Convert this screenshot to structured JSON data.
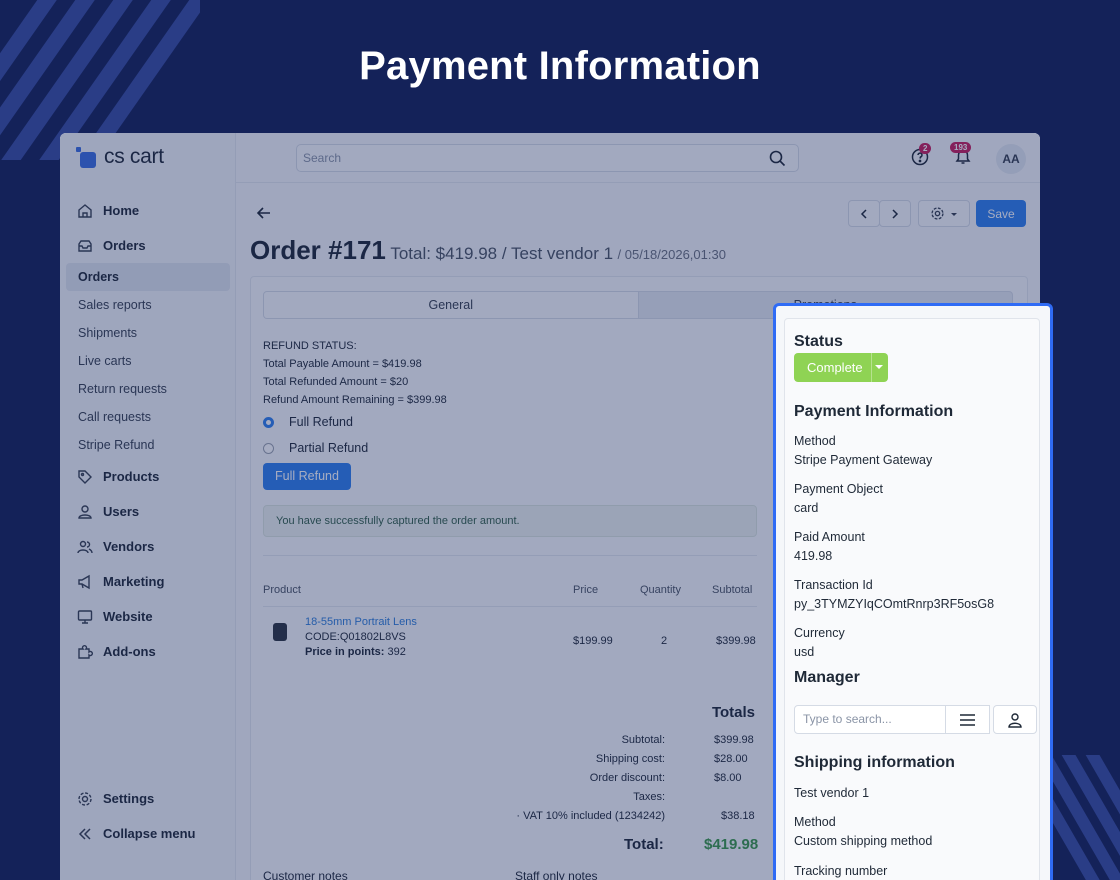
{
  "hero": {
    "title": "Payment Information"
  },
  "app": {
    "logo": "cs cart",
    "search_placeholder": "Search",
    "notifications_count": "2",
    "alerts_count": "193",
    "avatar_initials": "AA"
  },
  "sidebar": {
    "items": [
      {
        "label": "Home",
        "icon": "home-icon"
      },
      {
        "label": "Orders",
        "icon": "orders-icon"
      }
    ],
    "order_subitems": [
      "Orders",
      "Sales reports",
      "Shipments",
      "Live carts",
      "Return requests",
      "Call requests",
      "Stripe Refund"
    ],
    "items_after": [
      {
        "label": "Products",
        "icon": "tag-icon"
      },
      {
        "label": "Users",
        "icon": "user-icon"
      },
      {
        "label": "Vendors",
        "icon": "users-icon"
      },
      {
        "label": "Marketing",
        "icon": "megaphone-icon"
      },
      {
        "label": "Website",
        "icon": "monitor-icon"
      },
      {
        "label": "Add-ons",
        "icon": "puzzle-icon"
      }
    ],
    "settings": "Settings",
    "collapse": "Collapse menu"
  },
  "toolbar": {
    "save_label": "Save"
  },
  "order": {
    "title": "Order #171",
    "summary": "Total: $419.98 / Test vendor 1",
    "date": "/ 05/18/2026,01:30"
  },
  "tabs": [
    "General",
    "Promotions"
  ],
  "refund": {
    "status_label": "REFUND STATUS:",
    "payable": "Total Payable Amount = $419.98",
    "refunded": "Total Refunded Amount = $20",
    "remaining": "Refund Amount Remaining = $399.98",
    "option_full": "Full Refund",
    "option_partial": "Partial Refund",
    "button": "Full Refund"
  },
  "alert": "You have successfully captured the order amount.",
  "products_table": {
    "headers": [
      "Product",
      "Price",
      "Quantity",
      "Subtotal"
    ],
    "rows": [
      {
        "name": "18-55mm Portrait Lens",
        "code": "CODE:Q01802L8VS",
        "points_label": "Price in points:",
        "points_value": "392",
        "price": "$199.99",
        "quantity": "2",
        "subtotal": "$399.98"
      }
    ]
  },
  "totals": {
    "title": "Totals",
    "rows": [
      {
        "label": "Subtotal:",
        "value": "$399.98"
      },
      {
        "label": "Shipping cost:",
        "value": "$28.00"
      },
      {
        "label": "Order discount:",
        "value": "$8.00"
      },
      {
        "label": "Taxes:",
        "value": ""
      },
      {
        "label": "· VAT 10% included (1234242)",
        "value": "$38.18"
      }
    ],
    "total_label": "Total:",
    "total_value": "$419.98"
  },
  "notes": {
    "customer": "Customer notes",
    "staff": "Staff only notes"
  },
  "panel": {
    "status_heading": "Status",
    "status_value": "Complete",
    "payment_heading": "Payment Information",
    "fields": [
      {
        "label": "Method",
        "value": "Stripe Payment Gateway"
      },
      {
        "label": "Payment Object",
        "value": "card"
      },
      {
        "label": "Paid Amount",
        "value": "419.98"
      },
      {
        "label": "Transaction Id",
        "value": "py_3TYMZYIqCOmtRnrp3RF5osG8"
      },
      {
        "label": "Currency",
        "value": "usd"
      }
    ],
    "manager_heading": "Manager",
    "manager_placeholder": "Type to search...",
    "shipping_heading": "Shipping information",
    "shipping_vendor": "Test vendor 1",
    "shipping_method_label": "Method",
    "shipping_method_value": "Custom shipping method",
    "tracking_label": "Tracking number"
  },
  "colors": {
    "background": "#142259",
    "accent": "#2f80ed",
    "highlight_border": "#2f6bf5",
    "status_complete": "#8fd354",
    "total_green": "#3c9a4a"
  }
}
